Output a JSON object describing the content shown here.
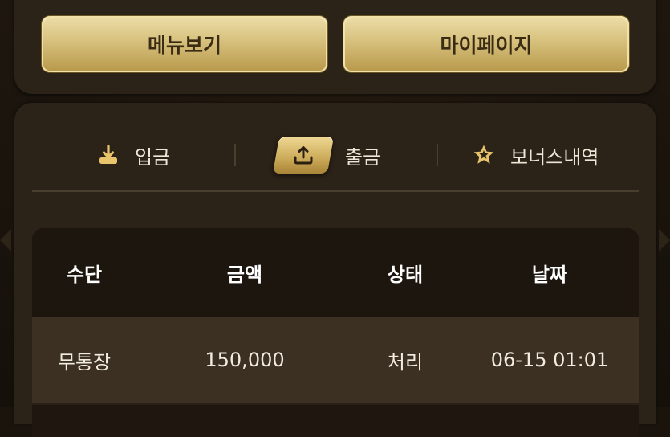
{
  "top_buttons": {
    "menu_label": "메뉴보기",
    "mypage_label": "마이페이지"
  },
  "tabs": [
    {
      "label": "입금",
      "icon": "download-icon",
      "active": false
    },
    {
      "label": "출금",
      "icon": "upload-icon",
      "active": true
    },
    {
      "label": "보너스내역",
      "icon": "star-icon",
      "active": false
    }
  ],
  "table": {
    "headers": [
      "수단",
      "금액",
      "상태",
      "날짜"
    ],
    "rows": [
      {
        "method": "무통장",
        "amount": "150,000",
        "status": "처리",
        "date": "06-15 01:01"
      }
    ]
  },
  "colors": {
    "gold": "#d6c07c",
    "panel": "#2b2218",
    "background": "#1a140d"
  }
}
